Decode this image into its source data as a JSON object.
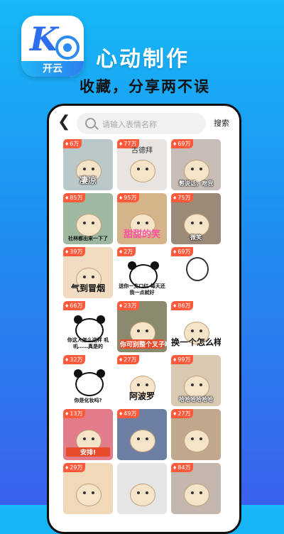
{
  "app": {
    "logo_label": "开云",
    "headline": "心动制作",
    "subline": "收藏，分享两不误"
  },
  "colors": {
    "accent": "#2d8cf0",
    "badge": "#ff5a3c",
    "background_top": "#16b8f6",
    "background_bottom": "#3a62ee"
  },
  "topbar": {
    "back_icon": "chevron-left-icon",
    "search_placeholder": "请输入表情名称",
    "search_button": "搜索"
  },
  "tiles": [
    {
      "count": "6万",
      "caption": "凄凉",
      "bg": "#b9c9c9",
      "style": "white"
    },
    {
      "count": "77万",
      "caption": "古德拜",
      "bg": "#e7e4e2",
      "style": "top"
    },
    {
      "count": "69万",
      "caption": "憋说话，吻我",
      "bg": "#c8bdb6",
      "style": "small-white"
    },
    {
      "count": "85万",
      "caption": "社林都出来一下了",
      "bg": "#9fb8a0",
      "style": "multi"
    },
    {
      "count": "95万",
      "caption": "甜甜的笑",
      "bg": "#d6b48a",
      "style": "pink"
    },
    {
      "count": "75万",
      "caption": "微笑",
      "bg": "#9b8a78",
      "style": "small-white"
    },
    {
      "count": "39万",
      "caption": "气到冒烟",
      "bg": "#f2dcc1",
      "style": "plain"
    },
    {
      "count": "2万",
      "caption": "送你一支口红 每天还我一点就好",
      "bg": "#ffffff",
      "style": "multi"
    },
    {
      "count": "69万",
      "caption": "",
      "bg": "#ffffff",
      "style": "doodle"
    },
    {
      "count": "66万",
      "caption": "你这人怎么这样 叽叽……真是的",
      "bg": "#ffffff",
      "style": "multi"
    },
    {
      "count": "23万",
      "caption": "你可别整个叉子吧",
      "bg": "#8a8a6e",
      "style": "red"
    },
    {
      "count": "86万",
      "caption": "换一个怎么样",
      "bg": "#ffffff",
      "style": "plain"
    },
    {
      "count": "32万",
      "caption": "你是化妆吗?",
      "bg": "#ffffff",
      "style": "multi"
    },
    {
      "count": "27万",
      "caption": "阿波罗",
      "bg": "#ffffff",
      "style": "plain"
    },
    {
      "count": "99万",
      "caption": "哈哈哈哈哈哈",
      "bg": "#d9c9b2",
      "style": "small-white"
    },
    {
      "count": "13万",
      "caption": "安排!",
      "bg": "#e27b8a",
      "style": "red"
    },
    {
      "count": "49万",
      "caption": "",
      "bg": "#6d7fa3",
      "style": "plain"
    },
    {
      "count": "27万",
      "caption": "",
      "bg": "#bfa88c",
      "style": "plain"
    },
    {
      "count": "29万",
      "caption": "",
      "bg": "#f0d8b8",
      "style": "plain"
    },
    {
      "count": "",
      "caption": "",
      "bg": "#e5e5e5",
      "style": "plain"
    },
    {
      "count": "84万",
      "caption": "",
      "bg": "#c4b8ae",
      "style": "plain"
    }
  ]
}
